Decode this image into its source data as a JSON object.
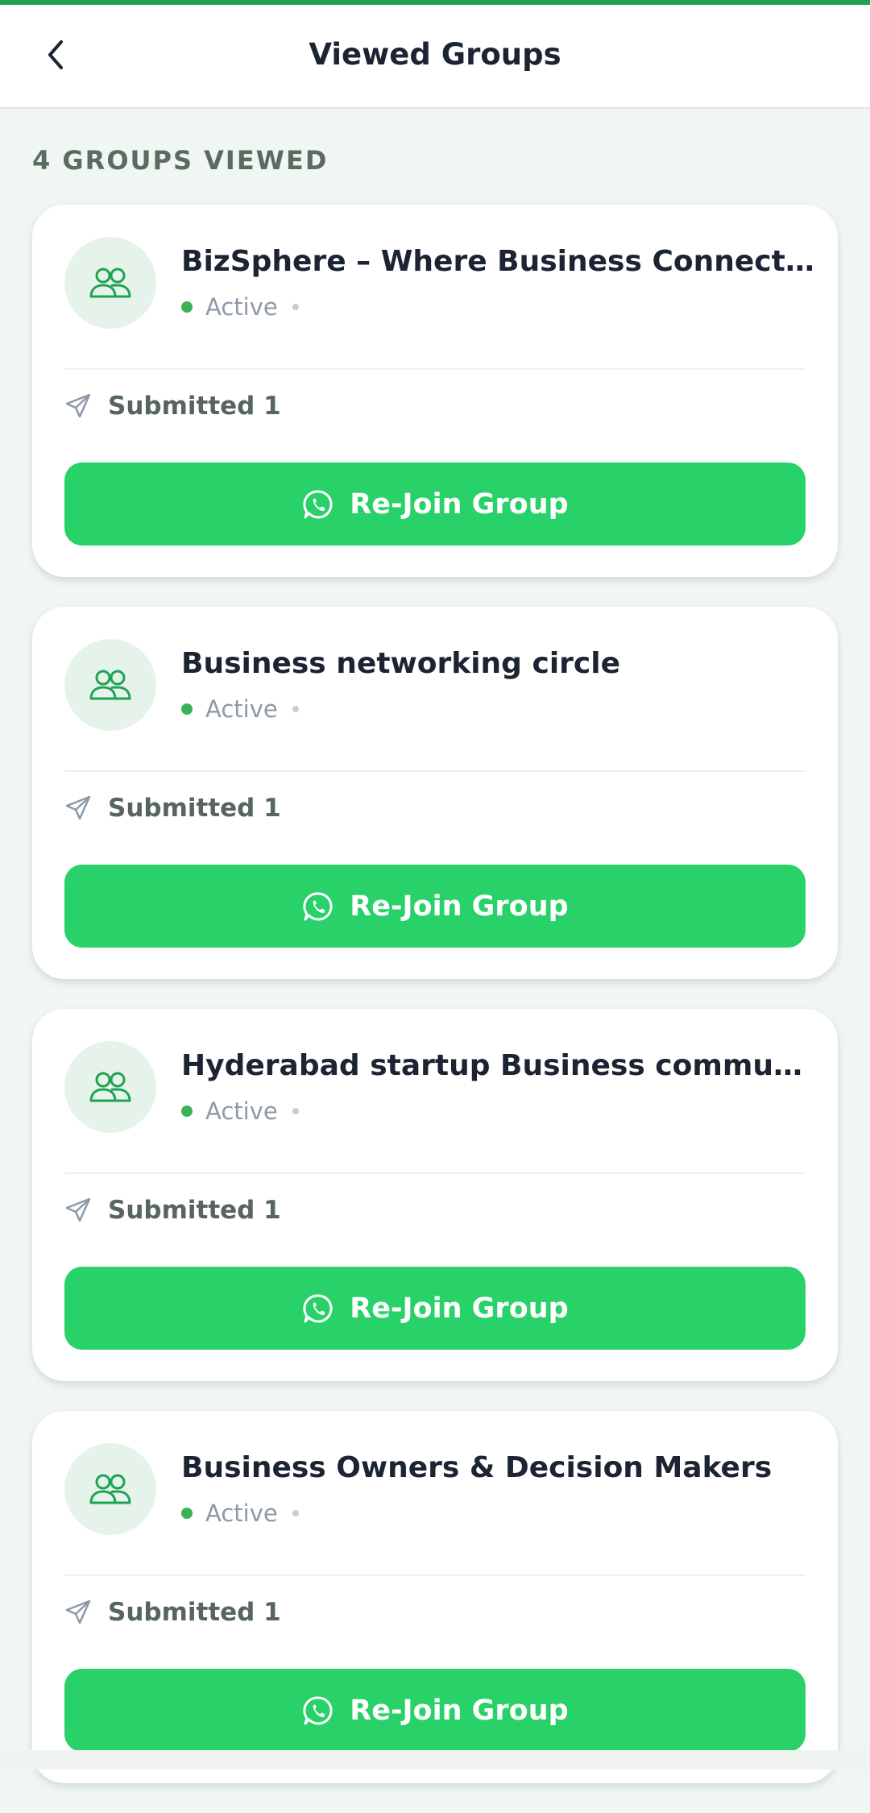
{
  "header": {
    "title": "Viewed Groups",
    "back_icon": "chevron-left-icon"
  },
  "section": {
    "label": "4 GROUPS VIEWED"
  },
  "colors": {
    "accent": "#29D169",
    "status_active": "#3DB05A",
    "top_strip": "#1FA352"
  },
  "groups": [
    {
      "name": "BizSphere – Where Business Connects & Grows",
      "status": "Active",
      "submitted": "Submitted 1",
      "button_label": "Re-Join Group"
    },
    {
      "name": "Business networking circle",
      "status": "Active",
      "submitted": "Submitted 1",
      "button_label": "Re-Join Group"
    },
    {
      "name": "Hyderabad startup Business community",
      "status": "Active",
      "submitted": "Submitted 1",
      "button_label": "Re-Join Group"
    },
    {
      "name": "Business Owners & Decision Makers",
      "status": "Active",
      "submitted": "Submitted 1",
      "button_label": "Re-Join Group"
    }
  ]
}
